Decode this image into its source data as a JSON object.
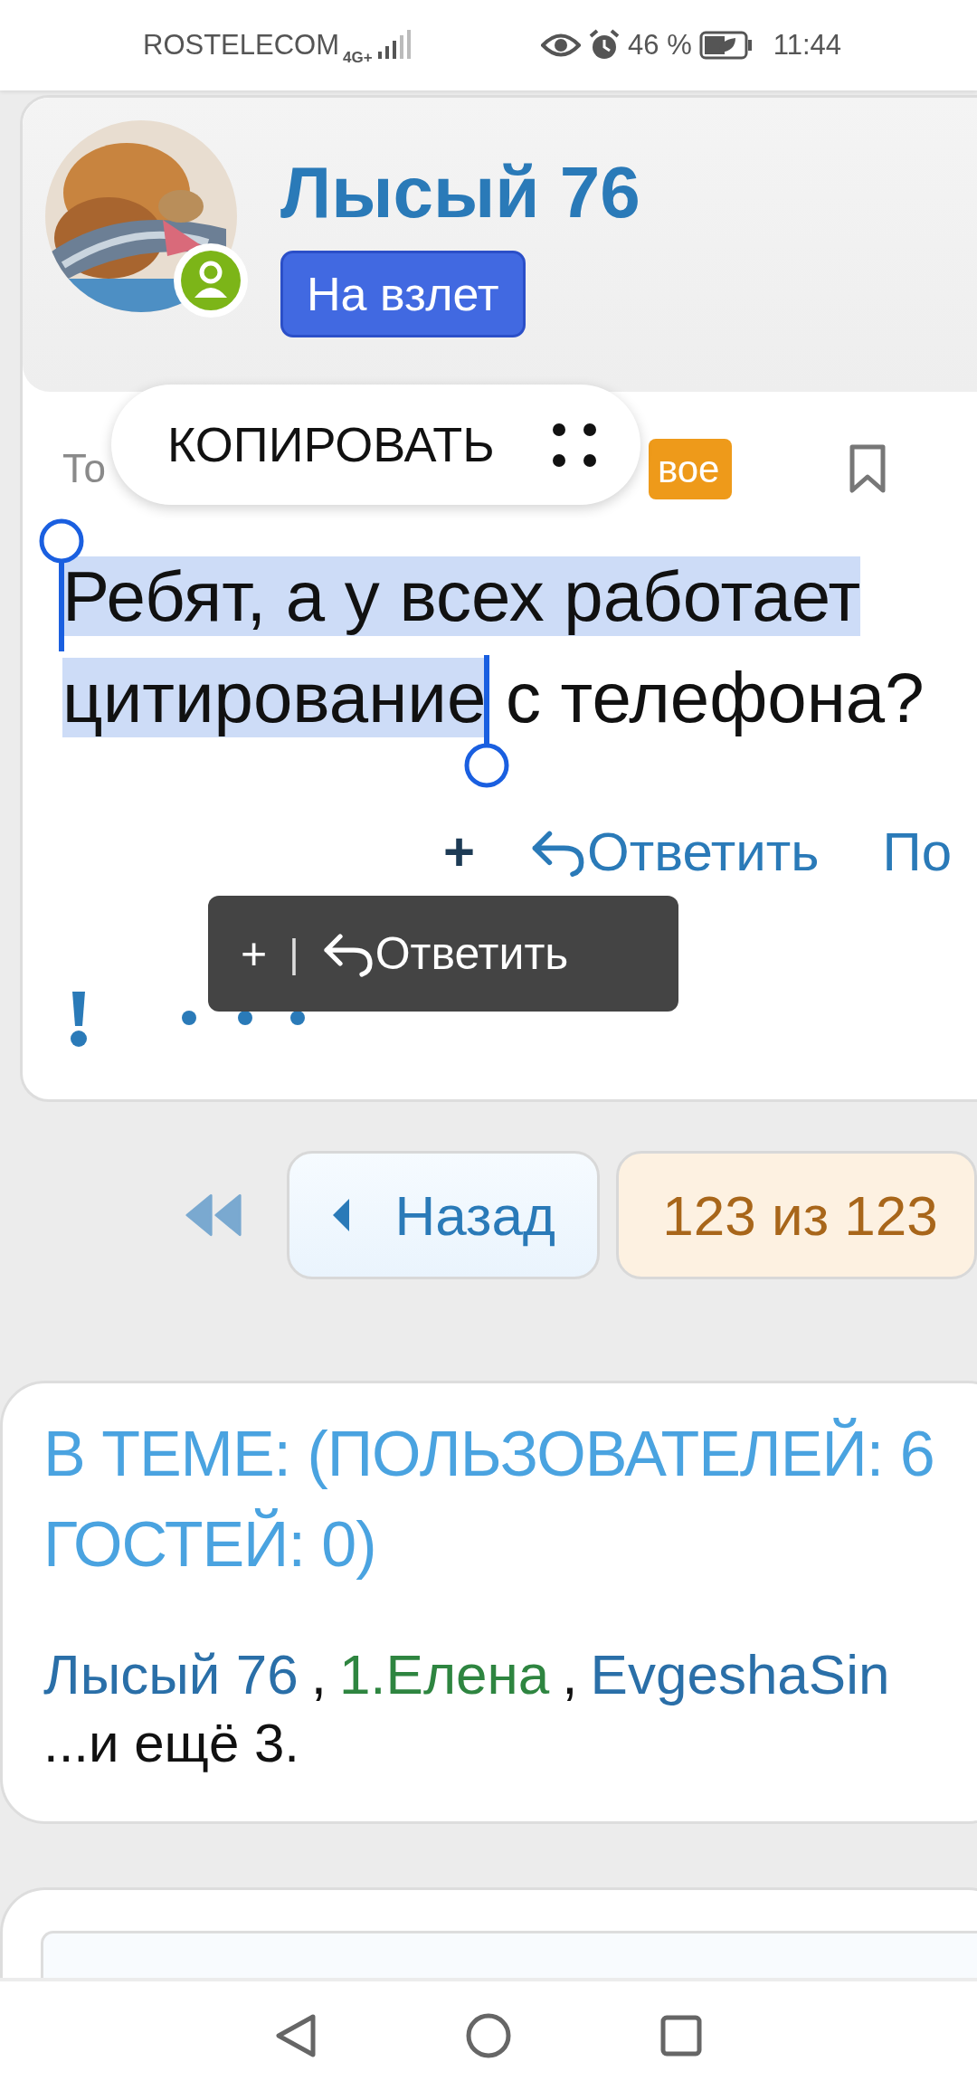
{
  "status_bar": {
    "carrier": "ROSTELECOM",
    "network": "4G+",
    "battery": "46 %",
    "time": "11:44"
  },
  "profile": {
    "username": "Лысый 76",
    "rank": "На взлет",
    "online": true
  },
  "post": {
    "date": "То",
    "badge": "вое",
    "text_selected": "Ребят, а у всех работает цитирование",
    "text_rest": " с телефона?",
    "actions": [
      {
        "kind": "plus",
        "label": "+"
      },
      {
        "kind": "reply",
        "label": "Ответить"
      },
      {
        "kind": "link",
        "label": "По"
      }
    ]
  },
  "copy_popup": {
    "label": "КОПИРОВАТЬ"
  },
  "quote_toolbar": {
    "items": [
      {
        "kind": "plus",
        "label": "+"
      },
      {
        "kind": "separator",
        "label": "|"
      },
      {
        "kind": "reply",
        "label": "Ответить"
      }
    ]
  },
  "pagination": {
    "back": "Назад",
    "position": "123 из 123"
  },
  "online_users": {
    "heading_lines": [
      "В ТЕМЕ: (ПОЛЬЗОВАТЕЛЕЙ: 6",
      "ГОСТЕЙ: 0)"
    ],
    "users": [
      {
        "name": "Лысый 76",
        "color": "#2a6fa8"
      },
      {
        "name": "1.Елена",
        "color": "#2e8540"
      },
      {
        "name": "EvgeshaSin",
        "color": "#2a6fa8"
      }
    ],
    "separator": ",",
    "more": "...и ещё 3."
  }
}
